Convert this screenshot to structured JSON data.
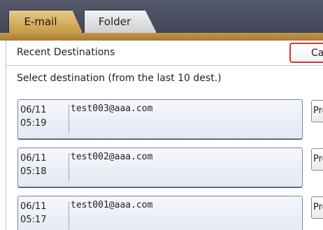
{
  "tabs": [
    {
      "label": "E-mail",
      "selected": true
    },
    {
      "label": "Folder",
      "selected": false
    }
  ],
  "panel": {
    "title": "Recent Destinations",
    "cancel_label": "Can",
    "instruction": "Select destination (from the last 10 dest.)"
  },
  "destinations": [
    {
      "date": "06/11",
      "time": "05:19",
      "email": "test003@aaa.com",
      "program_label": "Pro"
    },
    {
      "date": "06/11",
      "time": "05:18",
      "email": "test002@aaa.com",
      "program_label": "Pro"
    },
    {
      "date": "06/11",
      "time": "05:17",
      "email": "test001@aaa.com",
      "program_label": "Pro"
    }
  ],
  "colors": {
    "tab_selected": "#c79a45",
    "tabbar_bg": "#484c5e",
    "cancel_border": "#d0353d",
    "row_border": "#7b86a6"
  }
}
